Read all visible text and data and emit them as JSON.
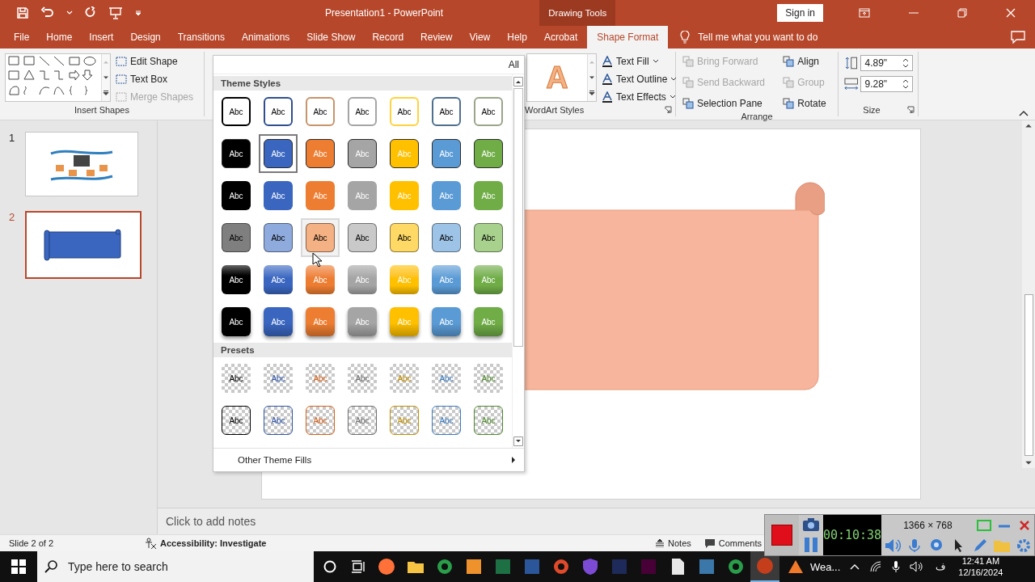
{
  "window": {
    "title": "Presentation1  -  PowerPoint",
    "context_tab": "Drawing Tools",
    "sign_in": "Sign in"
  },
  "tabs": [
    {
      "label": "File",
      "selected": false
    },
    {
      "label": "Home",
      "selected": false
    },
    {
      "label": "Insert",
      "selected": false
    },
    {
      "label": "Design",
      "selected": false
    },
    {
      "label": "Transitions",
      "selected": false
    },
    {
      "label": "Animations",
      "selected": false
    },
    {
      "label": "Slide Show",
      "selected": false
    },
    {
      "label": "Record",
      "selected": false
    },
    {
      "label": "Review",
      "selected": false
    },
    {
      "label": "View",
      "selected": false
    },
    {
      "label": "Help",
      "selected": false
    },
    {
      "label": "Acrobat",
      "selected": false
    },
    {
      "label": "Shape Format",
      "selected": true
    }
  ],
  "tell_me": "Tell me what you want to do",
  "ribbon": {
    "insert_shapes": {
      "label": "Insert Shapes",
      "commands": [
        {
          "label": "Edit Shape",
          "disabled": false
        },
        {
          "label": "Text Box",
          "disabled": false
        },
        {
          "label": "Merge Shapes",
          "disabled": true
        }
      ]
    },
    "wordart": {
      "label": "WordArt Styles",
      "sample": "A",
      "commands": [
        {
          "label": "Text Fill",
          "disabled": false
        },
        {
          "label": "Text Outline",
          "disabled": false
        },
        {
          "label": "Text Effects",
          "disabled": false
        }
      ]
    },
    "arrange": {
      "label": "Arrange",
      "commands": [
        {
          "label": "Bring Forward",
          "disabled": true
        },
        {
          "label": "Send Backward",
          "disabled": true
        },
        {
          "label": "Selection Pane",
          "disabled": false
        },
        {
          "label": "Align",
          "disabled": false
        },
        {
          "label": "Group",
          "disabled": true
        },
        {
          "label": "Rotate",
          "disabled": false
        }
      ]
    },
    "size": {
      "label": "Size",
      "height": "4.89\"",
      "width": "9.28\""
    }
  },
  "gallery": {
    "all_label": "All",
    "sections": [
      {
        "title": "Theme Styles",
        "rows": [
          {
            "kind": "outline",
            "cells": [
              {
                "label": "Abc",
                "color": "#000000",
                "selected": false,
                "hovered": false
              },
              {
                "label": "Abc",
                "color": "#2f4f8f",
                "selected": false,
                "hovered": false
              },
              {
                "label": "Abc",
                "color": "#c8946a",
                "selected": false,
                "hovered": false
              },
              {
                "label": "Abc",
                "color": "#a5a5a5",
                "selected": false,
                "hovered": false
              },
              {
                "label": "Abc",
                "color": "#ffd23f",
                "selected": false,
                "hovered": false
              },
              {
                "label": "Abc",
                "color": "#4f6f8f",
                "selected": false,
                "hovered": false
              },
              {
                "label": "Abc",
                "color": "#9aa58a",
                "selected": false,
                "hovered": false
              }
            ]
          },
          {
            "kind": "bordered",
            "cells": [
              {
                "label": "Abc",
                "color": "#000000",
                "selected": false,
                "hovered": false
              },
              {
                "label": "Abc",
                "color": "#3a66c0",
                "selected": true,
                "hovered": false
              },
              {
                "label": "Abc",
                "color": "#ed7d31",
                "selected": false,
                "hovered": false
              },
              {
                "label": "Abc",
                "color": "#a5a5a5",
                "selected": false,
                "hovered": false
              },
              {
                "label": "Abc",
                "color": "#ffc000",
                "selected": false,
                "hovered": false
              },
              {
                "label": "Abc",
                "color": "#5b9bd5",
                "selected": false,
                "hovered": false
              },
              {
                "label": "Abc",
                "color": "#70ad47",
                "selected": false,
                "hovered": false
              }
            ]
          },
          {
            "kind": "filled",
            "cells": [
              {
                "label": "Abc",
                "color": "#000000",
                "selected": false,
                "hovered": false
              },
              {
                "label": "Abc",
                "color": "#3a66c0",
                "selected": false,
                "hovered": false
              },
              {
                "label": "Abc",
                "color": "#ed7d31",
                "selected": false,
                "hovered": false
              },
              {
                "label": "Abc",
                "color": "#a5a5a5",
                "selected": false,
                "hovered": false
              },
              {
                "label": "Abc",
                "color": "#ffc000",
                "selected": false,
                "hovered": false
              },
              {
                "label": "Abc",
                "color": "#5b9bd5",
                "selected": false,
                "hovered": false
              },
              {
                "label": "Abc",
                "color": "#70ad47",
                "selected": false,
                "hovered": false
              }
            ]
          },
          {
            "kind": "light",
            "cells": [
              {
                "label": "Abc",
                "color": "#7f7f7f",
                "selected": false,
                "hovered": false
              },
              {
                "label": "Abc",
                "color": "#8faadc",
                "selected": false,
                "hovered": false
              },
              {
                "label": "Abc",
                "color": "#f4b183",
                "selected": false,
                "hovered": true
              },
              {
                "label": "Abc",
                "color": "#c9c9c9",
                "selected": false,
                "hovered": false
              },
              {
                "label": "Abc",
                "color": "#ffd966",
                "selected": false,
                "hovered": false
              },
              {
                "label": "Abc",
                "color": "#9dc3e6",
                "selected": false,
                "hovered": false
              },
              {
                "label": "Abc",
                "color": "#a9d18e",
                "selected": false,
                "hovered": false
              }
            ]
          },
          {
            "kind": "gradient",
            "cells": [
              {
                "label": "Abc",
                "color": "#000000",
                "selected": false,
                "hovered": false
              },
              {
                "label": "Abc",
                "color": "#3a66c0",
                "selected": false,
                "hovered": false
              },
              {
                "label": "Abc",
                "color": "#ed7d31",
                "selected": false,
                "hovered": false
              },
              {
                "label": "Abc",
                "color": "#a5a5a5",
                "selected": false,
                "hovered": false
              },
              {
                "label": "Abc",
                "color": "#ffc000",
                "selected": false,
                "hovered": false
              },
              {
                "label": "Abc",
                "color": "#5b9bd5",
                "selected": false,
                "hovered": false
              },
              {
                "label": "Abc",
                "color": "#70ad47",
                "selected": false,
                "hovered": false
              }
            ]
          },
          {
            "kind": "shadow",
            "cells": [
              {
                "label": "Abc",
                "color": "#000000",
                "selected": false,
                "hovered": false
              },
              {
                "label": "Abc",
                "color": "#3a66c0",
                "selected": false,
                "hovered": false
              },
              {
                "label": "Abc",
                "color": "#ed7d31",
                "selected": false,
                "hovered": false
              },
              {
                "label": "Abc",
                "color": "#a5a5a5",
                "selected": false,
                "hovered": false
              },
              {
                "label": "Abc",
                "color": "#ffc000",
                "selected": false,
                "hovered": false
              },
              {
                "label": "Abc",
                "color": "#5b9bd5",
                "selected": false,
                "hovered": false
              },
              {
                "label": "Abc",
                "color": "#70ad47",
                "selected": false,
                "hovered": false
              }
            ]
          }
        ]
      },
      {
        "title": "Presets",
        "rows": [
          {
            "kind": "transparent",
            "cells": [
              {
                "label": "Abc",
                "color": "#000000",
                "selected": false,
                "hovered": false
              },
              {
                "label": "Abc",
                "color": "#2f55a8",
                "selected": false,
                "hovered": false
              },
              {
                "label": "Abc",
                "color": "#d5621a",
                "selected": false,
                "hovered": false
              },
              {
                "label": "Abc",
                "color": "#6e6e6e",
                "selected": false,
                "hovered": false
              },
              {
                "label": "Abc",
                "color": "#c08f00",
                "selected": false,
                "hovered": false
              },
              {
                "label": "Abc",
                "color": "#3b7cc0",
                "selected": false,
                "hovered": false
              },
              {
                "label": "Abc",
                "color": "#4f8a2c",
                "selected": false,
                "hovered": false
              }
            ]
          },
          {
            "kind": "transparent-outline",
            "cells": [
              {
                "label": "Abc",
                "color": "#000000",
                "selected": false,
                "hovered": false
              },
              {
                "label": "Abc",
                "color": "#2f55a8",
                "selected": false,
                "hovered": false
              },
              {
                "label": "Abc",
                "color": "#d5621a",
                "selected": false,
                "hovered": false
              },
              {
                "label": "Abc",
                "color": "#6e6e6e",
                "selected": false,
                "hovered": false
              },
              {
                "label": "Abc",
                "color": "#c08f00",
                "selected": false,
                "hovered": false
              },
              {
                "label": "Abc",
                "color": "#3b7cc0",
                "selected": false,
                "hovered": false
              },
              {
                "label": "Abc",
                "color": "#4f8a2c",
                "selected": false,
                "hovered": false
              }
            ]
          }
        ]
      }
    ],
    "more": "Other Theme Fills"
  },
  "slides": [
    {
      "number": "1",
      "selected": false
    },
    {
      "number": "2",
      "selected": true
    }
  ],
  "notes_placeholder": "Click to add notes",
  "status_bar": {
    "slide": "Slide 2 of 2",
    "accessibility": "Accessibility: Investigate",
    "notes": "Notes",
    "comments": "Comments"
  },
  "recorder": {
    "timer": "00:10:38",
    "resolution": "1366 × 768"
  },
  "taskbar": {
    "search_placeholder": "Type here to search",
    "apps": [
      {
        "selected": false
      },
      {
        "selected": false
      },
      {
        "selected": false
      },
      {
        "selected": false
      },
      {
        "selected": false
      },
      {
        "selected": false
      },
      {
        "selected": false
      },
      {
        "selected": false
      },
      {
        "selected": false
      },
      {
        "selected": false
      },
      {
        "selected": false
      },
      {
        "selected": false
      },
      {
        "selected": false
      },
      {
        "selected": true
      }
    ],
    "weather": "Wea...",
    "language": "ف",
    "time": "12:41 AM",
    "date": "12/16/2024"
  }
}
